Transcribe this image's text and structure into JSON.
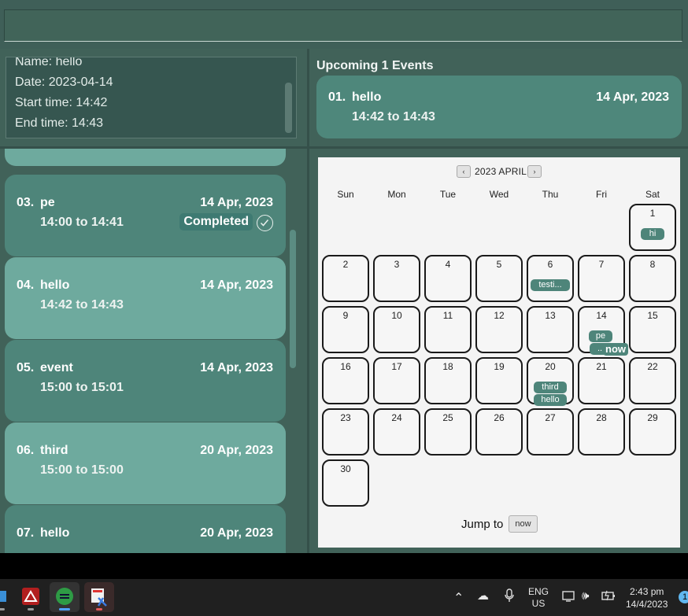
{
  "command": {
    "value": ""
  },
  "result": {
    "lines": [
      "Name: hello",
      "Date: 2023-04-14",
      "Start time: 14:42",
      "End time: 14:43"
    ]
  },
  "upcoming": {
    "title": "Upcoming 1 Events",
    "events": [
      {
        "index": "01.",
        "name": "hello",
        "date": "14 Apr, 2023",
        "time": "14:42 to 14:43"
      }
    ]
  },
  "event_list": [
    {
      "index": "03.",
      "name": "pe",
      "date": "14 Apr, 2023",
      "time": "14:00 to 14:41",
      "status": "Completed"
    },
    {
      "index": "04.",
      "name": "hello",
      "date": "14 Apr, 2023",
      "time": "14:42 to 14:43"
    },
    {
      "index": "05.",
      "name": "event",
      "date": "14 Apr, 2023",
      "time": "15:00 to 15:01"
    },
    {
      "index": "06.",
      "name": "third",
      "date": "20 Apr, 2023",
      "time": "15:00 to 15:00"
    },
    {
      "index": "07.",
      "name": "hello",
      "date": "20 Apr, 2023",
      "time": ""
    }
  ],
  "calendar": {
    "prev": "‹",
    "next": "›",
    "label": "2023 APRIL",
    "weekdays": [
      "Sun",
      "Mon",
      "Tue",
      "Wed",
      "Thu",
      "Fri",
      "Sat"
    ],
    "first_weekday": 6,
    "days_in_month": 30,
    "events": {
      "1": [
        "hi"
      ],
      "6": [
        "testi..."
      ],
      "14": [
        "pe",
        ".."
      ],
      "20": [
        "third",
        "hello"
      ]
    },
    "now_marker": "now",
    "jump_label": "Jump to",
    "jump_button": "now"
  },
  "taskbar": {
    "lang_top": "ENG",
    "lang_bottom": "US",
    "time": "2:43 pm",
    "date": "14/4/2023",
    "notification_count": "1"
  }
}
